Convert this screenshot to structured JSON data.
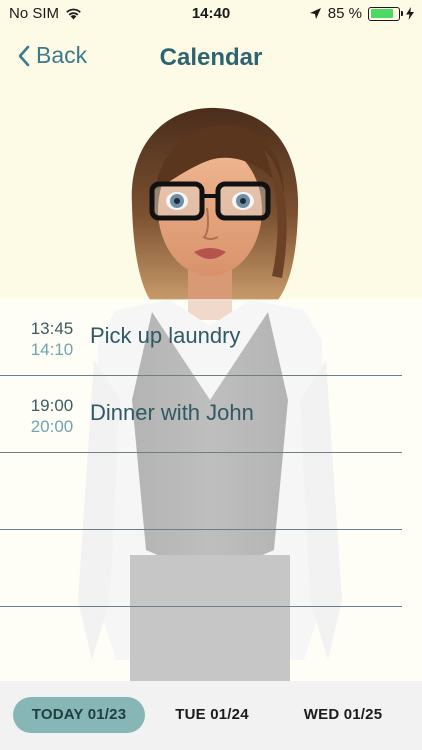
{
  "status_bar": {
    "carrier": "No SIM",
    "time": "14:40",
    "battery_percent": "85 %",
    "battery_level": 0.85
  },
  "nav": {
    "back_label": "Back",
    "title": "Calendar"
  },
  "events": [
    {
      "start": "13:45",
      "end": "14:10",
      "title": "Pick up laundry"
    },
    {
      "start": "19:00",
      "end": "20:00",
      "title": "Dinner with John"
    },
    {
      "start": "",
      "end": "",
      "title": ""
    },
    {
      "start": "",
      "end": "",
      "title": ""
    }
  ],
  "tabs": [
    {
      "label": "TODAY 01/23",
      "active": true
    },
    {
      "label": "TUE 01/24",
      "active": false
    },
    {
      "label": "WED 01/25",
      "active": false
    }
  ],
  "colors": {
    "header_background": "#fdfbe6",
    "accent": "#3b7a8c",
    "active_tab": "#86b6b6",
    "battery": "#4cd964"
  }
}
